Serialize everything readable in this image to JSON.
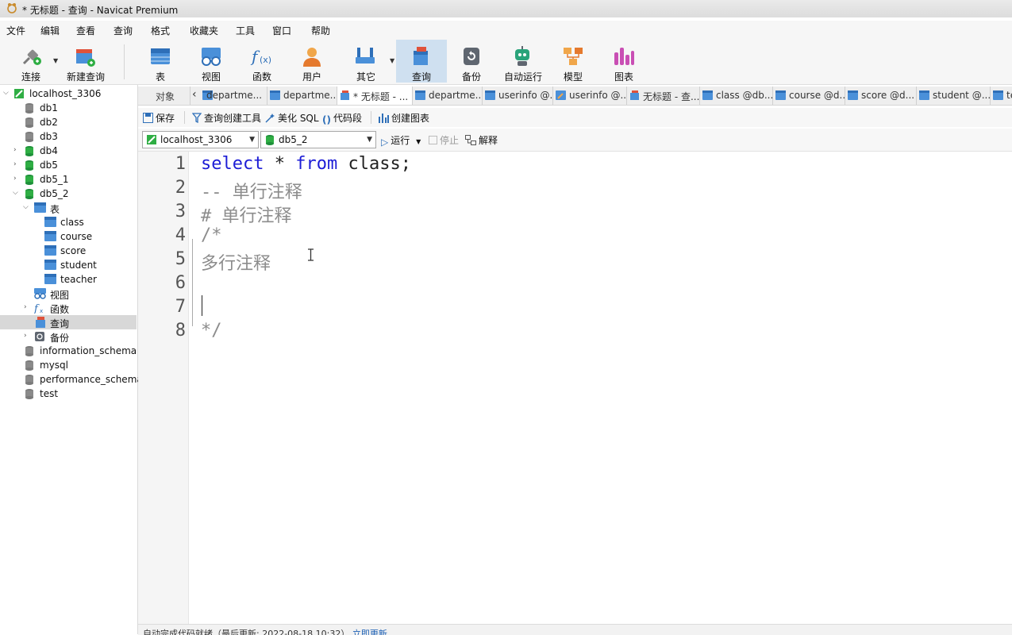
{
  "window": {
    "title": "* 无标题 - 查询 - Navicat Premium"
  },
  "menu": [
    "文件",
    "编辑",
    "查看",
    "查询",
    "格式",
    "收藏夹",
    "工具",
    "窗口",
    "帮助"
  ],
  "toolbar": {
    "connect": "连接",
    "new_query": "新建查询",
    "table": "表",
    "view": "视图",
    "function": "函数",
    "user": "用户",
    "other": "其它",
    "query": "查询",
    "backup": "备份",
    "automation": "自动运行",
    "model": "模型",
    "chart": "图表"
  },
  "sidebar": {
    "connection": "localhost_3306",
    "db1": "db1",
    "db2": "db2",
    "db3": "db3",
    "db4": "db4",
    "db5": "db5",
    "db5_1": "db5_1",
    "db5_2": "db5_2",
    "tables_node": "表",
    "tables": [
      "class",
      "course",
      "score",
      "student",
      "teacher"
    ],
    "views_node": "视图",
    "functions_node": "函数",
    "queries_node": "查询",
    "backups_node": "备份",
    "information_schema": "information_schema",
    "mysql": "mysql",
    "performance_schema": "performance_schema",
    "test": "test"
  },
  "tabs": {
    "objects": "对象",
    "items": [
      "departme...",
      "departme...",
      "* 无标题 - ...",
      "departme...",
      "userinfo @...",
      "userinfo @...",
      "无标题 - 查...",
      "class @db...",
      "course @d...",
      "score @d...",
      "student @...",
      "te"
    ]
  },
  "query_toolbar": {
    "save": "保存",
    "builder": "查询创建工具",
    "beautify": "美化 SQL",
    "snippet": "代码段",
    "create_chart": "创建图表"
  },
  "conn_row": {
    "connection": "localhost_3306",
    "database": "db5_2",
    "run": "运行",
    "stop": "停止",
    "explain": "解释"
  },
  "editor": {
    "line_numbers": [
      "1",
      "2",
      "3",
      "4",
      "5",
      "6",
      "7",
      "8"
    ],
    "line1": {
      "kw1": "select",
      "mid": " * ",
      "kw2": "from",
      "rest": " class;"
    },
    "line2": "-- 单行注释",
    "line3": "# 单行注释",
    "line4": "/*",
    "line5": "多行注释",
    "line8": "*/"
  },
  "status": {
    "text": "自动完成代码就绪（最后更新: 2022-08-18 10:32）",
    "link": "立即更新"
  },
  "colors": {
    "keyword": "#1d1dd6",
    "comment": "#8c8c8c",
    "active_tool": "#cfe0f0",
    "selection": "#d8d8d8"
  }
}
